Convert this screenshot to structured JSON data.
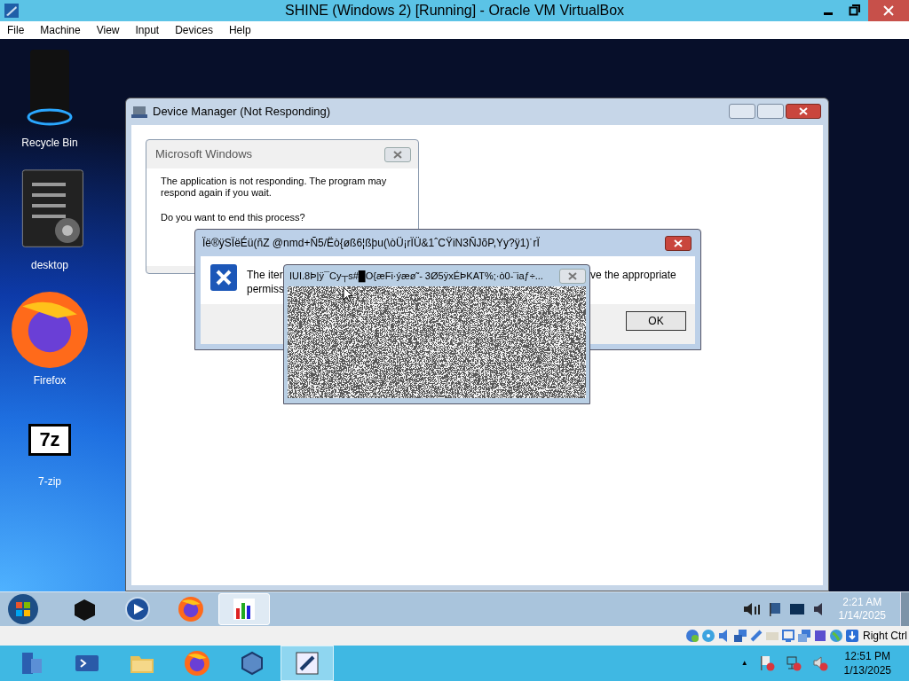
{
  "host_window": {
    "title": "SHINE (Windows 2) [Running] - Oracle VM VirtualBox",
    "menu": [
      "File",
      "Machine",
      "View",
      "Input",
      "Devices",
      "Help"
    ]
  },
  "desktop_icons": [
    {
      "label": "Recycle Bin",
      "kind": "bin"
    },
    {
      "label": "desktop",
      "kind": "doc"
    },
    {
      "label": "Firefox",
      "kind": "firefox"
    },
    {
      "label": "7-zip",
      "kind": "zip",
      "glyph": "7z"
    }
  ],
  "device_manager": {
    "title": "Device Manager (Not Responding)",
    "dialog": {
      "title": "Microsoft Windows",
      "message": "The application is not responding. The program may respond again if you wait.",
      "question": "Do you want to end this process?"
    }
  },
  "error_dialog": {
    "title": "Ïë®ÿSÏëÉü(ñZ  @nmd+Ñ5/Ëò{øß6¦ßþu(\\òÜ¡rÏÜ&1ˆCŸiN3ÑJõP,Yy?ÿ1)˙rÏ",
    "text_left": "The iter",
    "text_right": "ve the appropriate",
    "text_line2": "permiss",
    "button": "OK"
  },
  "noise_window": {
    "title": "IUI.8Þ|ÿ¯Cy┬s#█O{æFi·ýæø˜-  3Ø5ÿxÉÞKAT%;·ò0-¨iaƒ÷..."
  },
  "guest_taskbar": {
    "apps": [
      {
        "kind": "box",
        "selected": false
      },
      {
        "kind": "media",
        "selected": false
      },
      {
        "kind": "firefox",
        "selected": false
      },
      {
        "kind": "chart",
        "selected": true
      }
    ],
    "time": "2:21 AM",
    "date": "1/14/2025"
  },
  "status_bar": {
    "host_key": "Right Ctrl"
  },
  "host_taskbar": {
    "apps": [
      {
        "kind": "server",
        "selected": false
      },
      {
        "kind": "shell",
        "selected": false
      },
      {
        "kind": "folder",
        "selected": false
      },
      {
        "kind": "firefox",
        "selected": false
      },
      {
        "kind": "vbox",
        "selected": false
      },
      {
        "kind": "vm",
        "selected": true
      }
    ],
    "tray_arrow": "▲",
    "time": "12:51 PM",
    "date": "1/13/2025"
  }
}
